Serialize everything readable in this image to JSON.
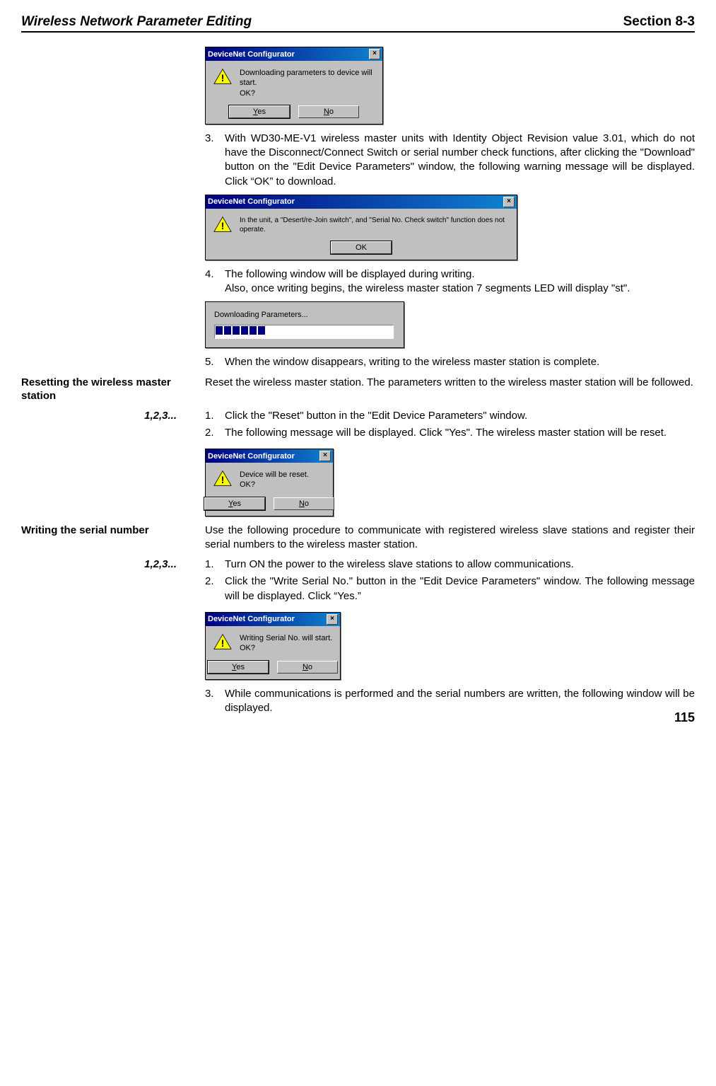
{
  "header": {
    "left": "Wireless Network Parameter Editing",
    "right": "Section 8-3"
  },
  "dialog1": {
    "title": "DeviceNet Configurator",
    "message": "Downloading parameters to device will start.\nOK?",
    "yes": "Yes",
    "no": "No",
    "close": "×"
  },
  "step3": {
    "num": "3.",
    "text": "With WD30-ME-V1 wireless master units with Identity Object Revision value 3.01, which do not have the Disconnect/Connect Switch or serial number check functions, after clicking the \"Download\" button on the \"Edit Device Parameters\" window, the following warning message will be displayed. Click “OK” to download."
  },
  "dialog2": {
    "title": "DeviceNet Configurator",
    "message": "In the unit, a \"Desert/re-Join switch\", and \"Serial No. Check switch\" function does not operate.",
    "ok": "OK",
    "close": "×"
  },
  "step4": {
    "num": "4.",
    "text": "The following window will be displayed during writing.",
    "text2": "Also, once writing begins, the wireless master station 7 segments LED will display \"st\"."
  },
  "progress": {
    "text": "Downloading Parameters..."
  },
  "step5": {
    "num": "5.",
    "text": "When the window disappears, writing to the wireless master station is complete."
  },
  "reset_section": {
    "heading": "Resetting the wireless master station",
    "intro": "Reset the wireless master station. The parameters written to the wireless master station will be followed.",
    "steps_label": "1,2,3...",
    "s1num": "1.",
    "s1": "Click the \"Reset\" button in the \"Edit Device Parameters\" window.",
    "s2num": "2.",
    "s2": "The following message will be displayed. Click \"Yes\". The wireless master station will be reset."
  },
  "dialog3": {
    "title": "DeviceNet Configurator",
    "message": "Device will be reset.\nOK?",
    "yes": "Yes",
    "no": "No",
    "close": "×"
  },
  "serial_section": {
    "heading": "Writing the serial number",
    "intro": "Use the following procedure to communicate with registered wireless slave stations and register their serial numbers to the wireless master station.",
    "steps_label": "1,2,3...",
    "s1num": "1.",
    "s1": "Turn ON the power to the wireless slave stations to allow communications.",
    "s2num": "2.",
    "s2": "Click the \"Write Serial No.\" button in the \"Edit Device Parameters\" window. The following message will be displayed. Click “Yes.”"
  },
  "dialog4": {
    "title": "DeviceNet Configurator",
    "message": "Writing Serial No. will start.\nOK?",
    "yes": "Yes",
    "no": "No",
    "close": "×"
  },
  "serial_step3": {
    "num": "3.",
    "text": "While communications is performed and the serial numbers are written, the following window will be displayed."
  },
  "pagenum": "115"
}
